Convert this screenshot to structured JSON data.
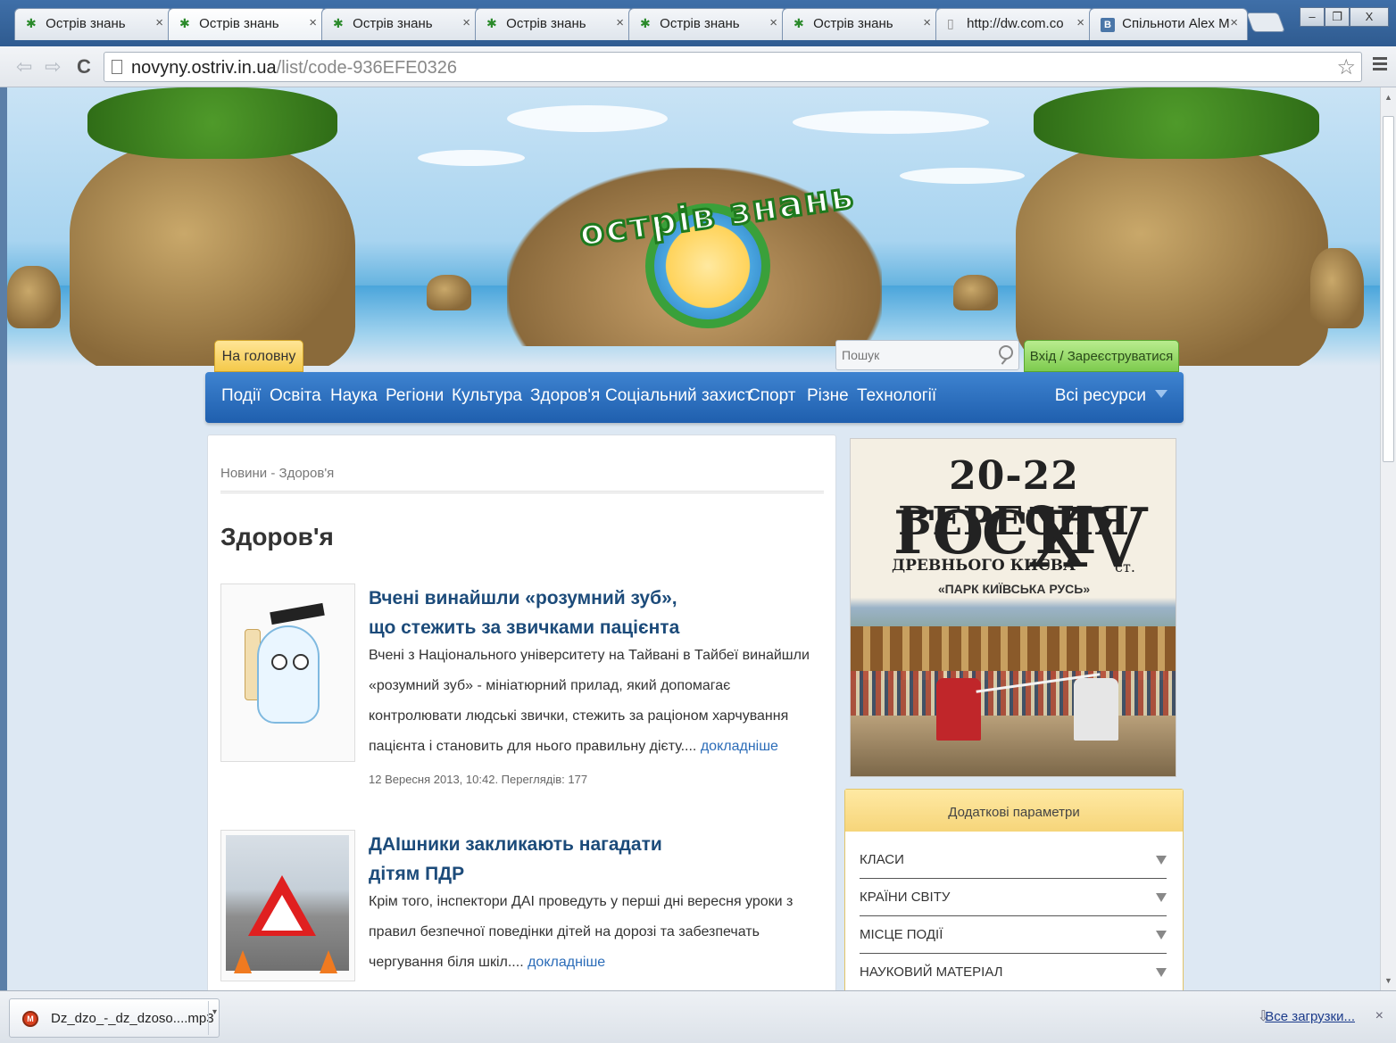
{
  "browser": {
    "tabs": [
      {
        "label": "Острів знань",
        "icon": "palm-icon"
      },
      {
        "label": "Острів знань",
        "icon": "palm-icon"
      },
      {
        "label": "Острів знань",
        "icon": "palm-icon"
      },
      {
        "label": "Острів знань",
        "icon": "palm-icon"
      },
      {
        "label": "Острів знань",
        "icon": "palm-icon"
      },
      {
        "label": "Острів знань",
        "icon": "palm-icon"
      },
      {
        "label": "http://dw.com.co",
        "icon": "page-icon"
      },
      {
        "label": "Спільноти Alex M",
        "icon": "vk-icon"
      }
    ],
    "url_host": "novyny.ostriv.in.ua",
    "url_path": "/list/code-936EFE0326"
  },
  "site": {
    "logo_text": "острів знань",
    "home_label": "На головну",
    "search_placeholder": "Пошук",
    "login_label": "Вхід / Зареєструватися",
    "nav": [
      "Події",
      "Освіта",
      "Наука",
      "Регіони",
      "Культура",
      "Здоров'я",
      "Соціальний захист",
      "Спорт",
      "Різне",
      "Технології"
    ],
    "all_resources": "Всі ресурси"
  },
  "main": {
    "breadcrumb": "Новини - Здоров'я",
    "title": "Здоров'я",
    "articles": [
      {
        "title": "Вчені винайшли «розумний зуб», що стежить за звичками пацієнта",
        "excerpt": "Вчені з Національного університету на Тайвані в Тайбеї винайшли «розумний зуб» - мініатюрний прилад, який допомагає контролювати людські звички, стежить за раціоном харчування пацієнта і становить для нього правильну дієту....",
        "more": "докладніше",
        "meta": "12 Вересня 2013, 10:42. Переглядів: 177"
      },
      {
        "title": "ДАІшники закликають нагадати дітям ПДР",
        "excerpt": "Крім того, інспектори ДАІ проведуть у перші дні вересня уроки з правил безпечної поведінки дітей на дорозі та забезпечать чергування біля шкіл....",
        "more": "докладніше"
      }
    ]
  },
  "sidebar": {
    "ad": {
      "date": "20-22 ВЕРЕСНЯ",
      "guests": "ГОСТІ",
      "century": "XV",
      "century_suffix": "ст.",
      "city": "ДРЕВНЬОГО КИЄВА",
      "park": "«ПАРК КИЇВСЬКА РУСЬ»"
    },
    "params_title": "Додаткові параметри",
    "params": [
      "Класи",
      "Країни світу",
      "Місце події",
      "Науковий матеріал"
    ]
  },
  "downloads": {
    "file": "Dz_dzo_-_dz_dzoso....mp3",
    "all_label": "Все загрузки..."
  },
  "colors": {
    "nav_blue": "#1f5fae",
    "home_tab_yellow": "#f4c94a",
    "login_green": "#7dcb4e",
    "article_title": "#1c4b7a",
    "link": "#2b6cb8"
  }
}
